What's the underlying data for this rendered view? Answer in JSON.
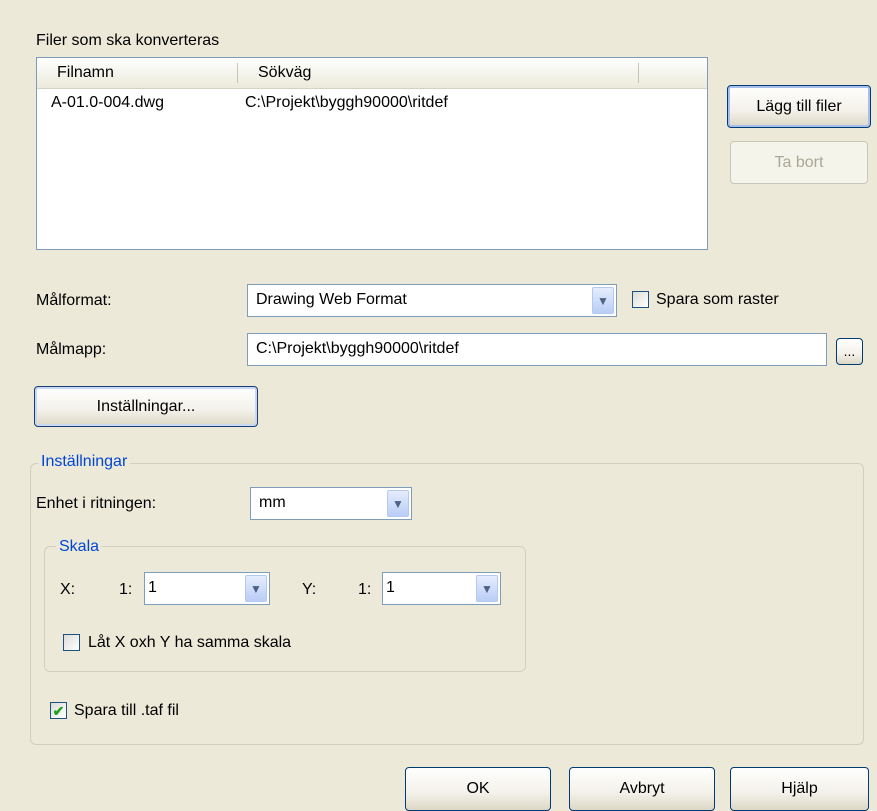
{
  "files_section": {
    "label": "Filer som ska konverteras",
    "columns": [
      "Filnamn",
      "Sökväg"
    ],
    "rows": [
      {
        "name": "A-01.0-004.dwg",
        "path": "C:\\Projekt\\byggh90000\\ritdef"
      }
    ],
    "add_button": "Lägg till filer",
    "remove_button": "Ta bort"
  },
  "target_format": {
    "label": "Målformat:",
    "value": "Drawing Web Format",
    "save_as_raster_label": "Spara som raster",
    "save_as_raster_checked": false
  },
  "target_folder": {
    "label": "Målmapp:",
    "value": "C:\\Projekt\\byggh90000\\ritdef",
    "browse_label": "..."
  },
  "settings_button": "Inställningar...",
  "settings_group": {
    "title": "Inställningar",
    "unit_label": "Enhet i ritningen:",
    "unit_value": "mm",
    "scale_group": {
      "title": "Skala",
      "x_label": "X:",
      "x_prefix": "1:",
      "x_value": "1",
      "y_label": "Y:",
      "y_prefix": "1:",
      "y_value": "1",
      "same_scale_label": "Låt X oxh Y ha samma skala",
      "same_scale_checked": false
    },
    "save_taf_label": "Spara till .taf fil",
    "save_taf_checked": true
  },
  "buttons": {
    "ok": "OK",
    "cancel": "Avbryt",
    "help": "Hjälp"
  },
  "icons": {
    "dropdown": "chevron-down-icon",
    "checkmark": "checkmark-icon"
  }
}
